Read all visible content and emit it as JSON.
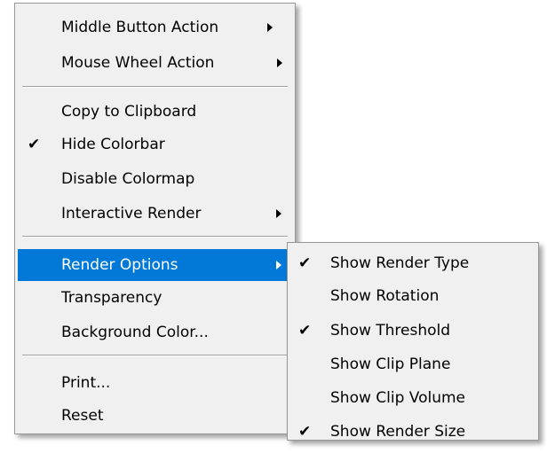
{
  "main_menu": {
    "items": [
      {
        "label": "Middle Button Action",
        "checked": false,
        "submenu": true
      },
      {
        "label": "Mouse Wheel Action",
        "checked": false,
        "submenu": true
      },
      {
        "label": "Copy to Clipboard",
        "checked": false,
        "submenu": false
      },
      {
        "label": "Hide Colorbar",
        "checked": true,
        "submenu": false
      },
      {
        "label": "Disable Colormap",
        "checked": false,
        "submenu": false
      },
      {
        "label": "Interactive Render",
        "checked": false,
        "submenu": true
      },
      {
        "label": "Render Options",
        "checked": false,
        "submenu": true,
        "highlighted": true
      },
      {
        "label": "Transparency",
        "checked": false,
        "submenu": false
      },
      {
        "label": "Background Color...",
        "checked": false,
        "submenu": false
      },
      {
        "label": "Print...",
        "checked": false,
        "submenu": false
      },
      {
        "label": "Reset",
        "checked": false,
        "submenu": false
      }
    ]
  },
  "render_options_submenu": {
    "items": [
      {
        "label": "Show Render Type",
        "checked": true
      },
      {
        "label": "Show Rotation",
        "checked": false
      },
      {
        "label": "Show Threshold",
        "checked": true
      },
      {
        "label": "Show Clip Plane",
        "checked": false
      },
      {
        "label": "Show Clip Volume",
        "checked": false
      },
      {
        "label": "Show Render Size",
        "checked": true
      }
    ]
  },
  "symbols": {
    "check_mark": "✔"
  },
  "colors": {
    "highlight": "#0078d7",
    "menu_background": "#f0f0f0"
  }
}
